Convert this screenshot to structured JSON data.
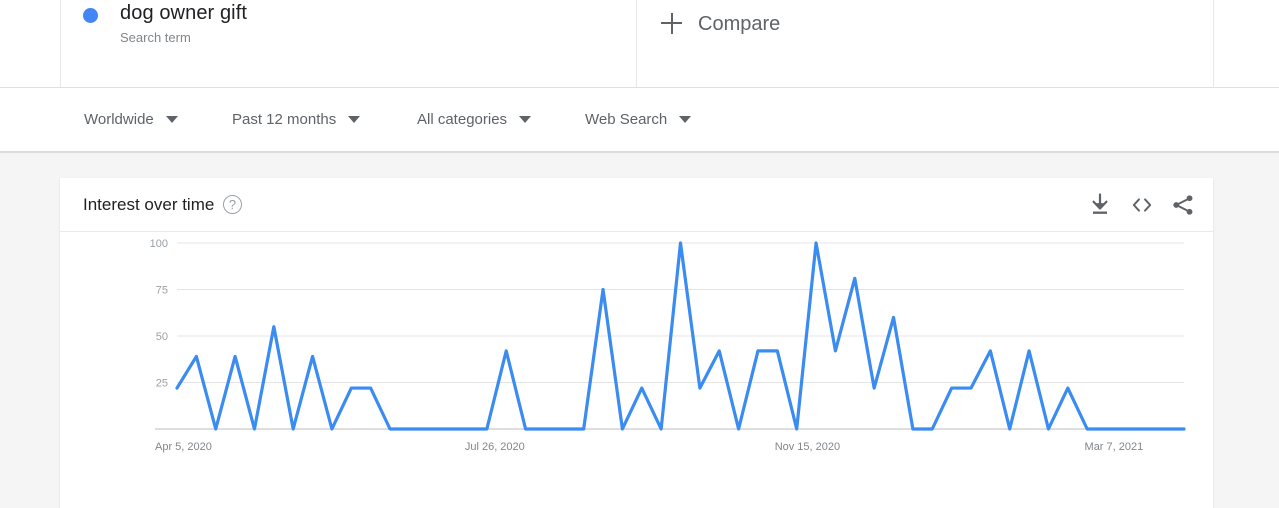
{
  "query_row": {
    "term": {
      "title": "dog owner gift",
      "subtitle": "Search term",
      "dot_color": "#4285f4"
    },
    "compare": {
      "label": "Compare",
      "icon": "plus-icon"
    }
  },
  "filters": [
    {
      "label": "Worldwide",
      "icon": "chevron-down-icon"
    },
    {
      "label": "Past 12 months",
      "icon": "chevron-down-icon"
    },
    {
      "label": "All categories",
      "icon": "chevron-down-icon"
    },
    {
      "label": "Web Search",
      "icon": "chevron-down-icon"
    }
  ],
  "card": {
    "title": "Interest over time",
    "help_glyph": "?",
    "actions": [
      {
        "name": "download-icon",
        "tooltip": "Download"
      },
      {
        "name": "embed-icon",
        "tooltip": "Embed"
      },
      {
        "name": "share-icon",
        "tooltip": "Share"
      }
    ]
  },
  "chart_data": {
    "type": "line",
    "title": "Interest over time",
    "xlabel": "",
    "ylabel": "",
    "ylim": [
      0,
      100
    ],
    "yticks": [
      25,
      50,
      75,
      100
    ],
    "grid": true,
    "legend": "none",
    "line_color": "#3a8bf2",
    "xtick_labels": [
      "Apr 5, 2020",
      "Jul 26, 2020",
      "Nov 15, 2020",
      "Mar 7, 2021"
    ],
    "xtick_indices": [
      0,
      16,
      32,
      48
    ],
    "series": [
      {
        "name": "dog owner gift",
        "values": [
          22,
          39,
          0,
          39,
          0,
          55,
          0,
          39,
          0,
          22,
          22,
          0,
          0,
          0,
          0,
          0,
          0,
          42,
          0,
          0,
          0,
          0,
          75,
          0,
          22,
          0,
          100,
          22,
          42,
          0,
          42,
          42,
          0,
          100,
          42,
          81,
          22,
          60,
          0,
          0,
          22,
          22,
          42,
          0,
          42,
          0,
          22,
          0,
          0,
          0,
          0,
          0,
          0
        ]
      }
    ]
  }
}
